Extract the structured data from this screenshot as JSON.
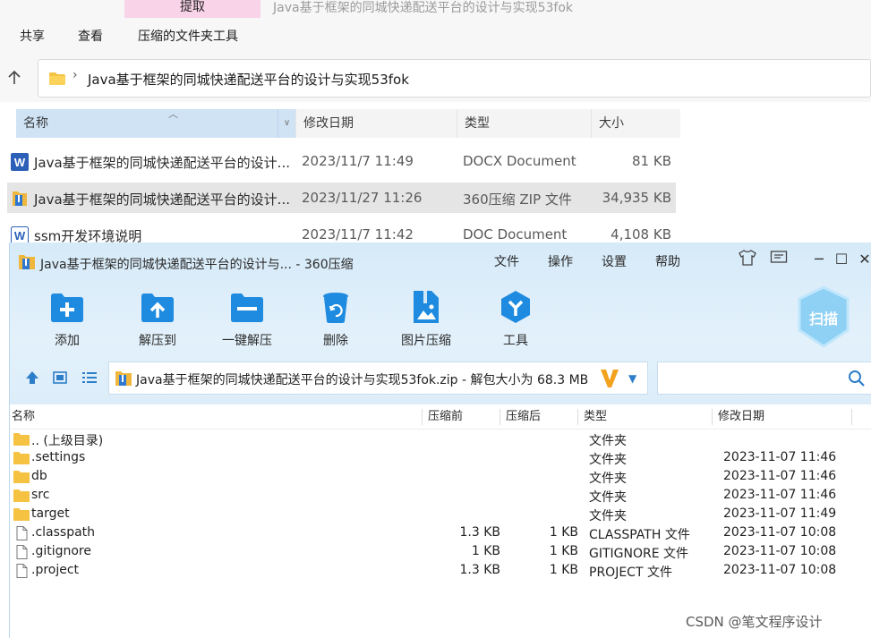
{
  "explorer": {
    "ribbon": {
      "extract_tab": "提取",
      "window_title": "Java基于框架的同城快递配送平台的设计与实现53fok",
      "menu": [
        "共享",
        "查看",
        "压缩的文件夹工具"
      ]
    },
    "address": {
      "path": "Java基于框架的同城快递配送平台的设计与实现53fok"
    },
    "columns": {
      "name": "名称",
      "date": "修改日期",
      "type": "类型",
      "size": "大小"
    },
    "files": [
      {
        "name": "Java基于框架的同城快递配送平台的设计...",
        "date": "2023/11/7 11:49",
        "type": "DOCX Document",
        "size": "81 KB",
        "icon": "word-doc-icon"
      },
      {
        "name": "Java基于框架的同城快递配送平台的设计...",
        "date": "2023/11/27 11:26",
        "type": "360压缩 ZIP 文件",
        "size": "34,935 KB",
        "icon": "zip-archive-icon"
      },
      {
        "name": "ssm开发环境说明",
        "date": "2023/11/7 11:42",
        "type": "DOC Document",
        "size": "4,108 KB",
        "icon": "word-doc-outline-icon"
      }
    ]
  },
  "zip": {
    "title": "Java基于框架的同城快递配送平台的设计与... - 360压缩",
    "menu": [
      "文件",
      "操作",
      "设置",
      "帮助"
    ],
    "toolbar": [
      {
        "label": "添加",
        "icon": "add-icon"
      },
      {
        "label": "解压到",
        "icon": "extract-to-icon"
      },
      {
        "label": "一键解压",
        "icon": "one-click-extract-icon"
      },
      {
        "label": "删除",
        "icon": "delete-icon"
      },
      {
        "label": "图片压缩",
        "icon": "image-compress-icon"
      },
      {
        "label": "工具",
        "icon": "tools-icon"
      }
    ],
    "scan_label": "扫描",
    "path_text": "Java基于框架的同城快递配送平台的设计与实现53fok.zip - 解包大小为 68.3 MB",
    "columns": {
      "name": "名称",
      "before": "压缩前",
      "after": "压缩后",
      "type": "类型",
      "date": "修改日期"
    },
    "entries": [
      {
        "name": ".. (上级目录)",
        "before": "",
        "after": "",
        "type": "文件夹",
        "date": "",
        "kind": "folder"
      },
      {
        "name": ".settings",
        "before": "",
        "after": "",
        "type": "文件夹",
        "date": "2023-11-07 11:46",
        "kind": "folder"
      },
      {
        "name": "db",
        "before": "",
        "after": "",
        "type": "文件夹",
        "date": "2023-11-07 11:46",
        "kind": "folder"
      },
      {
        "name": "src",
        "before": "",
        "after": "",
        "type": "文件夹",
        "date": "2023-11-07 11:46",
        "kind": "folder"
      },
      {
        "name": "target",
        "before": "",
        "after": "",
        "type": "文件夹",
        "date": "2023-11-07 11:49",
        "kind": "folder"
      },
      {
        "name": ".classpath",
        "before": "1.3 KB",
        "after": "1 KB",
        "type": "CLASSPATH 文件",
        "date": "2023-11-07 10:08",
        "kind": "file"
      },
      {
        "name": ".gitignore",
        "before": "1 KB",
        "after": "1 KB",
        "type": "GITIGNORE 文件",
        "date": "2023-11-07 10:08",
        "kind": "file"
      },
      {
        "name": ".project",
        "before": "1.3 KB",
        "after": "1 KB",
        "type": "PROJECT 文件",
        "date": "2023-11-07 10:08",
        "kind": "file"
      }
    ]
  },
  "watermark": "CSDN @笔文程序设计",
  "colors": {
    "accent_blue": "#1e8be0",
    "selection_blue": "#cfe3f5",
    "folder_yellow": "#f5c242",
    "zip_header": "#dcedf9"
  }
}
